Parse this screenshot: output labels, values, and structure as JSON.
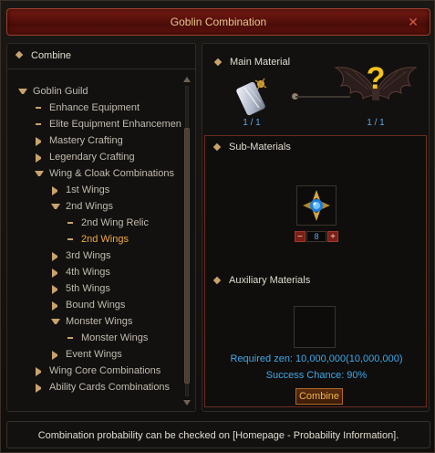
{
  "window": {
    "title": "Goblin Combination"
  },
  "left": {
    "header": "Combine",
    "tree": [
      {
        "label": "Goblin Guild",
        "icon": "arrow-down"
      },
      {
        "label": "Enhance Equipment",
        "icon": "dash"
      },
      {
        "label": "Elite Equipment Enhancemen",
        "icon": "dash"
      },
      {
        "label": "Mastery Crafting",
        "icon": "arrow-right"
      },
      {
        "label": "Legendary Crafting",
        "icon": "arrow-right"
      },
      {
        "label": "Wing & Cloak Combinations",
        "icon": "arrow-down"
      },
      {
        "label": "1st Wings",
        "icon": "arrow-right"
      },
      {
        "label": "2nd Wings",
        "icon": "arrow-down"
      },
      {
        "label": "2nd Wing Relic",
        "icon": "dash"
      },
      {
        "label": "2nd Wings",
        "icon": "dash",
        "selected": true
      },
      {
        "label": "3rd Wings",
        "icon": "arrow-right"
      },
      {
        "label": "4th Wings",
        "icon": "arrow-right"
      },
      {
        "label": "5th Wings",
        "icon": "arrow-right"
      },
      {
        "label": "Bound Wings",
        "icon": "arrow-right"
      },
      {
        "label": "Monster Wings",
        "icon": "arrow-down"
      },
      {
        "label": "Monster Wings",
        "icon": "dash"
      },
      {
        "label": "Event Wings",
        "icon": "arrow-right"
      },
      {
        "label": "Wing Core Combinations",
        "icon": "arrow-right"
      },
      {
        "label": "Ability Cards Combinations",
        "icon": "arrow-right"
      }
    ]
  },
  "main_material": {
    "header": "Main Material",
    "input_count": "1 / 1",
    "result_count": "1 / 1",
    "result_symbol": "?"
  },
  "sub_materials": {
    "header": "Sub-Materials",
    "quantity": "8",
    "minus": "−",
    "plus": "+"
  },
  "auxiliary": {
    "header": "Auxiliary Materials"
  },
  "info": {
    "required_zen": "Required zen: 10,000,000(10,000,000)",
    "success_chance": "Success Chance: 90%",
    "combine_label": "Combine"
  },
  "footer": {
    "message": "Combination probability can be checked on [Homepage - Probability Information]."
  },
  "colors": {
    "accent_gold": "#c8a36a",
    "selected_orange": "#f2a93c",
    "info_blue": "#3fa8e8",
    "title_red": "#7a1b14"
  },
  "icons": {
    "close": "close-icon",
    "main_material": "feather-scroll-icon",
    "result": "dark-wings-icon",
    "sub_material": "jewel-of-chaos-icon"
  }
}
